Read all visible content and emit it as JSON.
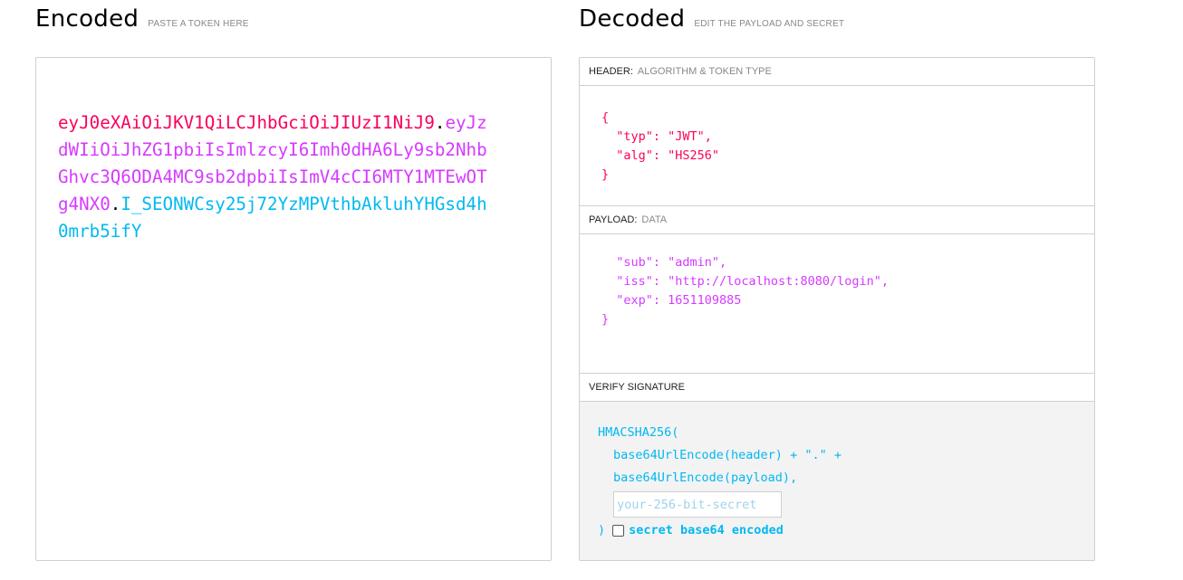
{
  "encoded": {
    "title": "Encoded",
    "subtitle": "PASTE A TOKEN HERE",
    "token": {
      "header": "eyJ0eXAiOiJKV1QiLCJhbGciOiJIUzI1NiJ9",
      "payload": "eyJzdWIiOiJhZG1pbiIsImlzcyI6Imh0dHA6Ly9sb2NhbGhvc3Q6ODA4MC9sb2dpbiIsImV4cCI6MTY1MTEwOTg4NX0",
      "signature": "I_SEONWCsy25j72YzMPVthbAkluhYHGsd4h0mrb5ifY",
      "dot": "."
    }
  },
  "decoded": {
    "title": "Decoded",
    "subtitle": "EDIT THE PAYLOAD AND SECRET",
    "header": {
      "label": "HEADER:",
      "sublabel": "ALGORITHM & TOKEN TYPE",
      "json_text": "{\n  \"typ\": \"JWT\",\n  \"alg\": \"HS256\"\n}"
    },
    "payload": {
      "label": "PAYLOAD:",
      "sublabel": "DATA",
      "json_text": "  \"sub\": \"admin\",\n  \"iss\": \"http://localhost:8080/login\",\n  \"exp\": 1651109885\n}"
    },
    "verify": {
      "label": "VERIFY SIGNATURE",
      "fn_open": "HMACSHA256(",
      "line1": "base64UrlEncode(header) + \".\" +",
      "line2": "base64UrlEncode(payload),",
      "secret_placeholder": "your-256-bit-secret",
      "close": ")",
      "b64_label": "secret base64 encoded"
    }
  },
  "colors": {
    "header": "#fb015b",
    "payload": "#d63aff",
    "signature": "#00b9f1"
  }
}
